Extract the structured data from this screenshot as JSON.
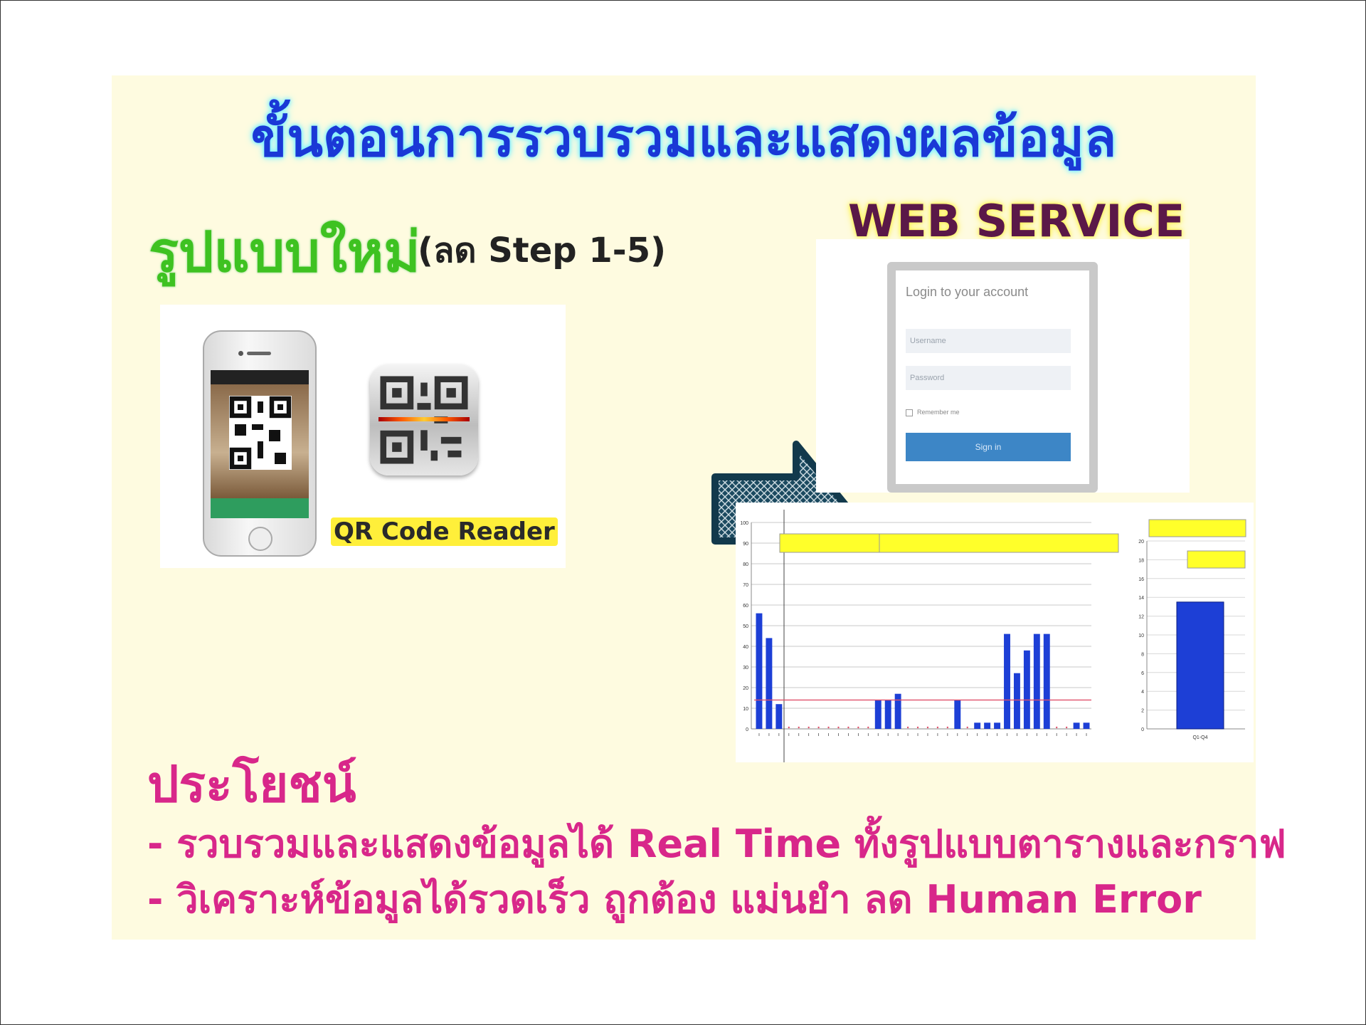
{
  "slide": {
    "title": "ขั้นตอนการรวบรวมและแสดงผลข้อมูล",
    "new_format": "รูปแบบใหม่",
    "new_format_sub": "(ลด Step 1-5)",
    "web_service": "WEB SERVICE",
    "qr_label": "QR Code Reader"
  },
  "login": {
    "title": "Login to your account",
    "username_placeholder": "Username",
    "password_placeholder": "Password",
    "remember": "Remember me",
    "sign_in": "Sign in"
  },
  "benefits": {
    "title": "ประโยชน์",
    "line1": "- รวบรวมและแสดงข้อมูลได้ Real Time ทั้งรูปแบบตารางและกราฟ",
    "line2": "- วิเคราะห์ข้อมูลได้รวดเร็ว ถูกต้อง แม่นยำ ลด Human Error"
  },
  "colors": {
    "title": "#1a38d6",
    "new_format": "#3ec221",
    "benefit": "#d8278a",
    "bar": "#1d3fd6",
    "target_line": "#e0506a",
    "legend_bg": "#ffff2a"
  },
  "chart_data": [
    {
      "type": "bar",
      "ylim": [
        0,
        100
      ],
      "yticks": [
        0,
        10,
        20,
        30,
        40,
        50,
        60,
        70,
        80,
        90,
        100
      ],
      "values": [
        56,
        44,
        12,
        0,
        0,
        0,
        0,
        0,
        0,
        0,
        0,
        0,
        14,
        14,
        17,
        0,
        0,
        0,
        0,
        0,
        14,
        0,
        3,
        3,
        3,
        46,
        27,
        38,
        46,
        46,
        0,
        0,
        3,
        3
      ],
      "target": 14
    },
    {
      "type": "bar",
      "categories": [
        "Q1-Q4"
      ],
      "values": [
        13.5
      ],
      "ylim": [
        0,
        20
      ],
      "yticks": [
        0,
        2,
        4,
        6,
        8,
        10,
        12,
        14,
        16,
        18,
        20
      ]
    }
  ]
}
